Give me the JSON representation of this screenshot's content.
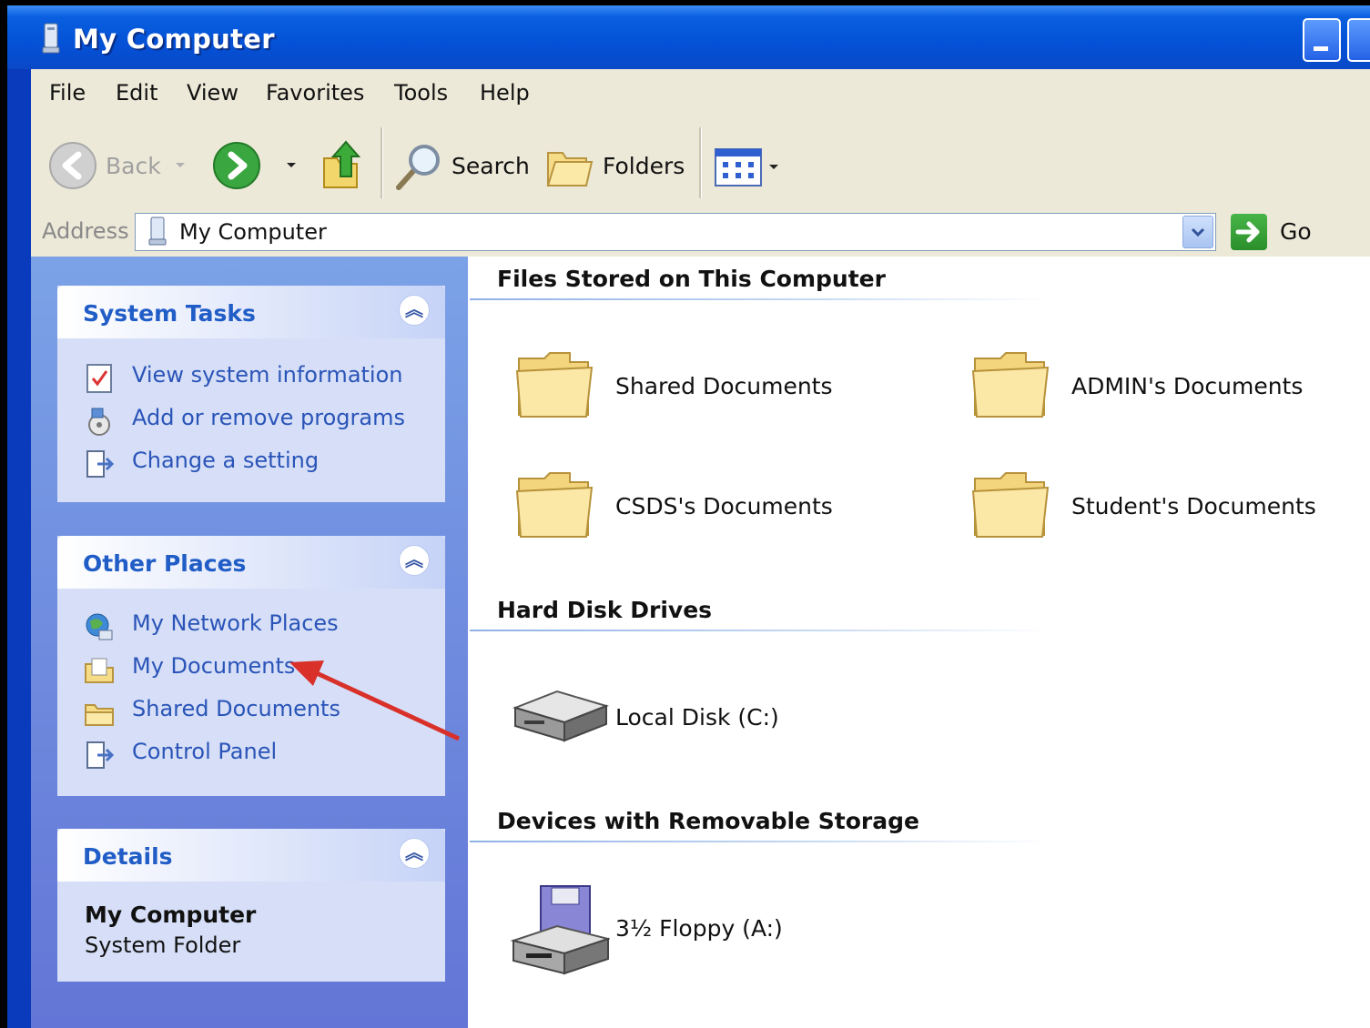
{
  "window": {
    "title": "My Computer"
  },
  "menu": [
    "File",
    "Edit",
    "View",
    "Favorites",
    "Tools",
    "Help"
  ],
  "toolbar": {
    "back_label": "Back",
    "search_label": "Search",
    "folders_label": "Folders"
  },
  "address": {
    "label": "Address",
    "value": "My Computer",
    "go_label": "Go"
  },
  "left_pane": {
    "system_tasks": {
      "title": "System Tasks",
      "items": [
        "View system information",
        "Add or remove programs",
        "Change a setting"
      ]
    },
    "other_places": {
      "title": "Other Places",
      "items": [
        "My Network Places",
        "My Documents",
        "Shared Documents",
        "Control Panel"
      ]
    },
    "details": {
      "title": "Details",
      "name": "My Computer",
      "type": "System Folder"
    }
  },
  "content": {
    "files_section": {
      "title": "Files Stored on This Computer",
      "items": [
        "Shared Documents",
        "ADMIN's Documents",
        "CSDS's Documents",
        "Student's Documents"
      ]
    },
    "hard_disk_section": {
      "title": "Hard Disk Drives",
      "items": [
        "Local Disk (C:)"
      ]
    },
    "removable_section": {
      "title": "Devices with Removable Storage",
      "items": [
        "3½ Floppy (A:)"
      ]
    }
  },
  "colors": {
    "title_bar": "#0451d6",
    "task_link": "#2a54b8",
    "panel_title": "#215dc6",
    "annotation_arrow": "#d9302a"
  }
}
